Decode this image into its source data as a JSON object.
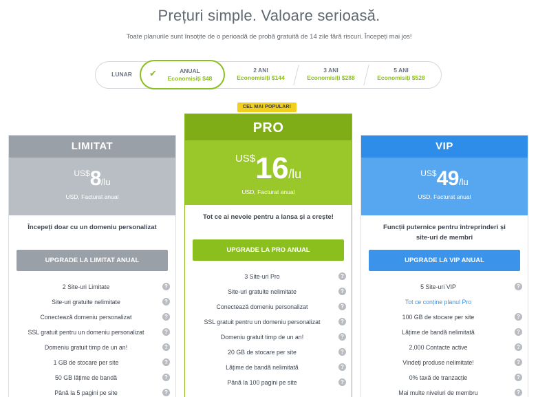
{
  "header": {
    "title": "Prețuri simple. Valoare serioasă.",
    "subtitle": "Toate planurile sunt însoțite de o perioadă de probă gratuită de 14 zile fără riscuri. Începeți mai jos!"
  },
  "periods": [
    {
      "label": "LUNAR",
      "save": ""
    },
    {
      "label": "ANUAL",
      "save": "Economisiți $48"
    },
    {
      "label": "2 ANI",
      "save": "Economisiți $144"
    },
    {
      "label": "3 ANI",
      "save": "Economisiți $288"
    },
    {
      "label": "5 ANI",
      "save": "Economisiți $528"
    }
  ],
  "selected_period": "ANUAL",
  "badge": "CEL MAI POPULAR!",
  "plans": [
    {
      "name": "LIMITAT",
      "currency": "US$",
      "price": "8",
      "per": "/lu",
      "billed": "USD, Facturat anual",
      "tagline": "Începeți doar cu un domeniu personalizat",
      "cta": "UPGRADE LA LIMITAT ANUAL",
      "features": [
        "2 Site-uri Limitate",
        "Site-uri gratuite nelimitate",
        "Conectează domeniu personalizat",
        "SSL gratuit pentru un domeniu personalizat",
        "Domeniu gratuit timp de un an!",
        "1 GB de stocare per site",
        "50 GB lățime de bandă",
        "Până la 5 pagini pe site"
      ]
    },
    {
      "name": "PRO",
      "currency": "US$",
      "price": "16",
      "per": "/lu",
      "billed": "USD, Facturat anual",
      "tagline": "Tot ce ai nevoie pentru a lansa și a crește!",
      "cta": "UPGRADE LA PRO ANUAL",
      "features": [
        "3 Site-uri Pro",
        "Site-uri gratuite nelimitate",
        "Conectează domeniu personalizat",
        "SSL gratuit pentru un domeniu personalizat",
        "Domeniu gratuit timp de un an!",
        "20 GB de stocare per site",
        "Lățime de bandă nelimitată",
        "Până la 100 pagini pe site"
      ]
    },
    {
      "name": "VIP",
      "currency": "US$",
      "price": "49",
      "per": "/lu",
      "billed": "USD, Facturat anual",
      "tagline": "Funcții puternice pentru întreprinderi și site-uri de membri",
      "cta": "UPGRADE LA VIP ANUAL",
      "features": [
        "5 Site-uri VIP",
        "Tot ce conține planul Pro",
        "100 GB de stocare per site",
        "Lățime de bandă nelimitată",
        "2,000 Contacte active",
        "Vindeți produse nelimitate!",
        "0% taxă de tranzacție",
        "Mai multe niveluri de membru"
      ]
    }
  ],
  "colors": {
    "accent_green": "#8bbf1d",
    "pro_header": "#7fad18",
    "vip_blue": "#2d8de8",
    "limitat_gray": "#9aa0a7",
    "badge_yellow": "#f2cf1d"
  },
  "icons": {
    "selected": "check-icon",
    "feature_help": "question-circle-icon"
  }
}
